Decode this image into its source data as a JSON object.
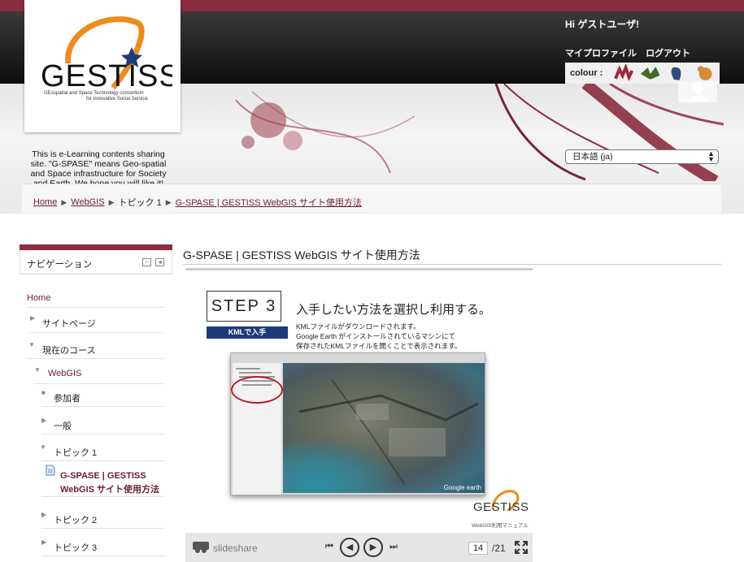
{
  "header": {
    "greeting": "Hi ゲストユーザ!",
    "profile_link": "マイプロファイル",
    "logout_link": "ログアウト",
    "colour_label": "colour :",
    "colour_swatches": [
      "#9a2c3d",
      "#3f6a2a",
      "#2f4f7a",
      "#d78a3a"
    ],
    "language": "日本語 (ja)"
  },
  "logo": {
    "word": "GESTISS",
    "sub1": "GEospatial and Space Technology consortium",
    "sub2": "for Innovative Social Service"
  },
  "tagline": "This is e-Learning contents sharing site. \"G-SPASE\" means Geo-spatial and Space infrastructure for Society and Earth. We hope you will like it!",
  "breadcrumb": {
    "home": "Home",
    "webgis": "WebGIS",
    "topic": "トピック 1",
    "current": "G-SPASE | GESTISS WebGIS サイト使用方法"
  },
  "nav": {
    "title": "ナビゲーション",
    "home": "Home",
    "site_pages": "サイトページ",
    "current_course": "現在のコース",
    "webgis": "WebGIS",
    "participants": "参加者",
    "general": "一般",
    "topic1": "トピック 1",
    "resource_line1": "G-SPASE | GESTISS",
    "resource_line2": "WebGIS サイト使用方法",
    "topic2": "トピック 2",
    "topic3": "トピック 3"
  },
  "main": {
    "title": "G-SPASE | GESTISS WebGIS サイト使用方法"
  },
  "slide": {
    "step": "STEP 3",
    "tag": "KMLで入手",
    "heading": "入手したい方法を選択し利用する。",
    "desc1": "KMLファイルがダウンロードされます。",
    "desc2": "Google Earth がインストールされているマシンにて",
    "desc3": "保存されたKMLファイルを開くことで表示されます。",
    "earth_brand": "Google earth",
    "logo": "GESTISS",
    "footer": "WebGIS利用マニュアル"
  },
  "player": {
    "brand": "slideshare",
    "current_page": "14",
    "total_pages": "/21"
  }
}
